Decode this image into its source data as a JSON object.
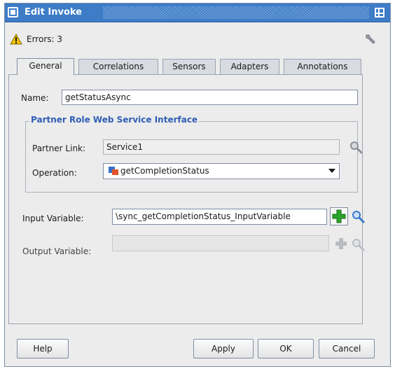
{
  "window": {
    "title": "Edit Invoke"
  },
  "errors": {
    "label": "Errors: 3"
  },
  "tabs": [
    {
      "label": "General"
    },
    {
      "label": "Correlations"
    },
    {
      "label": "Sensors"
    },
    {
      "label": "Adapters"
    },
    {
      "label": "Annotations"
    }
  ],
  "general": {
    "name_label": "Name:",
    "name_value": "getStatusAsync",
    "group_title": "Partner Role Web Service Interface",
    "partner_link_label": "Partner Link:",
    "partner_link_value": "Service1",
    "operation_label": "Operation:",
    "operation_value": "getCompletionStatus",
    "input_variable_label": "Input Variable:",
    "input_variable_value": "\\sync_getCompletionStatus_InputVariable",
    "output_variable_label": "Output Variable:",
    "output_variable_value": ""
  },
  "buttons": {
    "help": "Help",
    "apply": "Apply",
    "ok": "OK",
    "cancel": "Cancel"
  },
  "icons": {
    "window_menu": "window-menu-icon",
    "maximize": "maximize-icon",
    "warning": "warning-icon",
    "wrench": "wrench-icon",
    "search": "search-icon",
    "add": "add-icon",
    "operation": "operation-icon"
  },
  "colors": {
    "title_bar": "#3d7cc7",
    "group_title": "#2f5db5",
    "add_green": "#2aa52a",
    "search_blue": "#3a78c8",
    "warning_yellow": "#f2c200"
  }
}
